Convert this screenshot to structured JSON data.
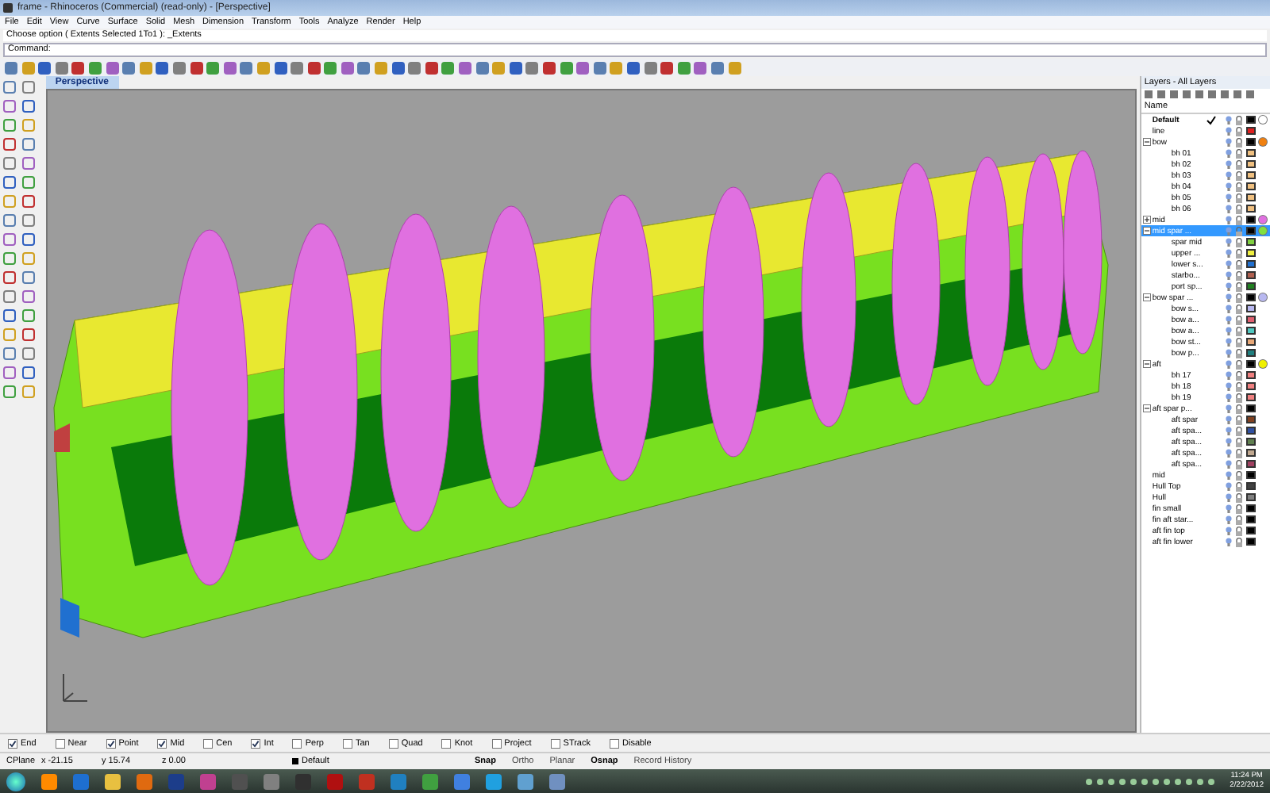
{
  "window": {
    "title": "frame - Rhinoceros (Commercial) (read-only) - [Perspective]"
  },
  "menu": [
    "File",
    "Edit",
    "View",
    "Curve",
    "Surface",
    "Solid",
    "Mesh",
    "Dimension",
    "Transform",
    "Tools",
    "Analyze",
    "Render",
    "Help"
  ],
  "command_history": "Choose option ( Extents  Selected  1To1 ): _Extents",
  "command_prompt": "Command:",
  "viewport": {
    "tab": "Perspective"
  },
  "layers": {
    "title": "Layers - All Layers",
    "column": "Name",
    "items": [
      {
        "name": "Default",
        "current": true,
        "color": "#000000",
        "material": {
          "color": "#ffffff"
        },
        "selected": false
      },
      {
        "name": "line",
        "color": "#e02020",
        "selected": false
      },
      {
        "name": "bow",
        "color": "#000000",
        "material": {
          "color": "#f08010"
        },
        "selected": false,
        "expanded": true,
        "children": [
          {
            "name": "bh 01",
            "color": "#f0c080",
            "selected": false
          },
          {
            "name": "bh 02",
            "color": "#f0c080",
            "selected": false
          },
          {
            "name": "bh 03",
            "color": "#f0c080",
            "selected": false
          },
          {
            "name": "bh 04",
            "color": "#f0c080",
            "selected": false
          },
          {
            "name": "bh 05",
            "color": "#f0c080",
            "selected": false
          },
          {
            "name": "bh 06",
            "color": "#f0c080",
            "selected": false
          }
        ]
      },
      {
        "name": "mid",
        "color": "#000000",
        "material": {
          "color": "#e070e0"
        },
        "selected": false,
        "expanded": false
      },
      {
        "name": "mid spar ...",
        "color": "#000000",
        "material": {
          "color": "#80e040"
        },
        "selected": true,
        "expanded": true,
        "children": [
          {
            "name": "spar mid",
            "color": "#80d040",
            "selected": false
          },
          {
            "name": "upper ...",
            "color": "#f0f040",
            "selected": false
          },
          {
            "name": "lower s...",
            "color": "#2070d0",
            "selected": false
          },
          {
            "name": "starbo...",
            "color": "#b06050",
            "selected": false
          },
          {
            "name": "port sp...",
            "color": "#208020",
            "selected": false
          }
        ]
      },
      {
        "name": "bow spar ...",
        "color": "#000000",
        "material": {
          "color": "#b8b8f0"
        },
        "selected": false,
        "expanded": true,
        "children": [
          {
            "name": "bow s...",
            "color": "#b8b8f0",
            "selected": false
          },
          {
            "name": "bow a...",
            "color": "#e06070",
            "selected": false
          },
          {
            "name": "bow a...",
            "color": "#50c8c0",
            "selected": false
          },
          {
            "name": "bow st...",
            "color": "#e8a878",
            "selected": false
          },
          {
            "name": "bow p...",
            "color": "#208080",
            "selected": false
          }
        ]
      },
      {
        "name": "aft",
        "color": "#000000",
        "material": {
          "color": "#f0f000"
        },
        "selected": false,
        "expanded": true,
        "children": [
          {
            "name": "bh 17",
            "color": "#f08080",
            "selected": false
          },
          {
            "name": "bh 18",
            "color": "#f08080",
            "selected": false
          },
          {
            "name": "bh 19",
            "color": "#f08080",
            "selected": false
          }
        ]
      },
      {
        "name": "aft spar p...",
        "color": "#000000",
        "selected": false,
        "expanded": true,
        "children": [
          {
            "name": "aft spar",
            "color": "#804020",
            "selected": false
          },
          {
            "name": "aft spa...",
            "color": "#3050a0",
            "selected": false
          },
          {
            "name": "aft spa...",
            "color": "#608050",
            "selected": false
          },
          {
            "name": "aft spa...",
            "color": "#c0a890",
            "selected": false
          },
          {
            "name": "aft spa...",
            "color": "#a04060",
            "selected": false
          }
        ]
      },
      {
        "name": "mid",
        "color": "#000000",
        "selected": false
      },
      {
        "name": "Hull Top",
        "color": "#404040",
        "selected": false
      },
      {
        "name": "Hull",
        "color": "#808080",
        "selected": false
      },
      {
        "name": "fin small",
        "color": "#000000",
        "selected": false
      },
      {
        "name": "fin aft star...",
        "color": "#000000",
        "selected": false
      },
      {
        "name": "aft fin top",
        "color": "#000000",
        "selected": false
      },
      {
        "name": "aft fin lower",
        "color": "#000000",
        "selected": false
      }
    ]
  },
  "osnaps": [
    {
      "label": "End",
      "checked": true
    },
    {
      "label": "Near",
      "checked": false
    },
    {
      "label": "Point",
      "checked": true
    },
    {
      "label": "Mid",
      "checked": true
    },
    {
      "label": "Cen",
      "checked": false
    },
    {
      "label": "Int",
      "checked": true
    },
    {
      "label": "Perp",
      "checked": false
    },
    {
      "label": "Tan",
      "checked": false
    },
    {
      "label": "Quad",
      "checked": false
    },
    {
      "label": "Knot",
      "checked": false
    },
    {
      "label": "Project",
      "checked": false
    },
    {
      "label": "STrack",
      "checked": false
    },
    {
      "label": "Disable",
      "checked": false
    }
  ],
  "status_bar": {
    "cplane": "CPlane",
    "x": "x -21.15",
    "y": "y 15.74",
    "z": "z 0.00",
    "layer": "Default",
    "toggles": [
      {
        "label": "Snap",
        "on": true
      },
      {
        "label": "Ortho",
        "on": false
      },
      {
        "label": "Planar",
        "on": false
      },
      {
        "label": "Osnap",
        "on": true
      },
      {
        "label": "Record History",
        "on": false
      }
    ]
  },
  "taskbar": {
    "time": "11:24 PM",
    "date": "2/22/2012"
  }
}
